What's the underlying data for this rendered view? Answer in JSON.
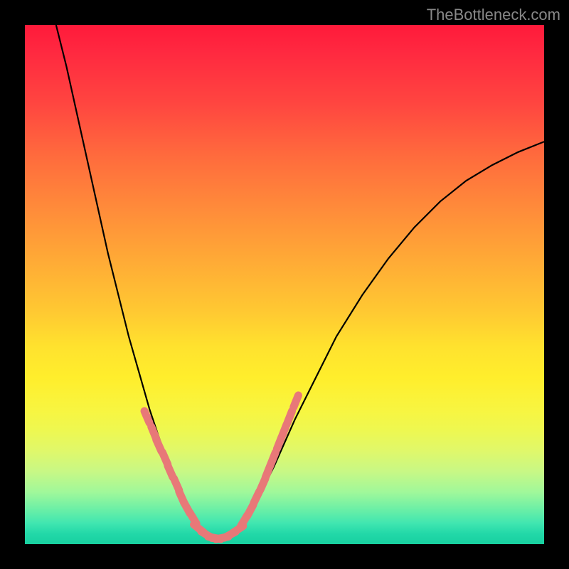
{
  "watermark": "TheBottleneck.com",
  "chart_data": {
    "type": "line",
    "title": "",
    "xlabel": "",
    "ylabel": "",
    "ylim": [
      0,
      1
    ],
    "xlim": [
      0,
      1
    ],
    "series": [
      {
        "name": "bottleneck-curve",
        "description": "V-shaped curve showing bottleneck percentage; minimum near x≈0.36",
        "curve_points": [
          {
            "x": 0.06,
            "y": 1.0
          },
          {
            "x": 0.08,
            "y": 0.92
          },
          {
            "x": 0.1,
            "y": 0.83
          },
          {
            "x": 0.12,
            "y": 0.74
          },
          {
            "x": 0.14,
            "y": 0.65
          },
          {
            "x": 0.16,
            "y": 0.56
          },
          {
            "x": 0.18,
            "y": 0.48
          },
          {
            "x": 0.2,
            "y": 0.4
          },
          {
            "x": 0.22,
            "y": 0.33
          },
          {
            "x": 0.24,
            "y": 0.26
          },
          {
            "x": 0.26,
            "y": 0.2
          },
          {
            "x": 0.28,
            "y": 0.15
          },
          {
            "x": 0.3,
            "y": 0.1
          },
          {
            "x": 0.32,
            "y": 0.06
          },
          {
            "x": 0.34,
            "y": 0.03
          },
          {
            "x": 0.36,
            "y": 0.01
          },
          {
            "x": 0.38,
            "y": 0.01
          },
          {
            "x": 0.4,
            "y": 0.02
          },
          {
            "x": 0.42,
            "y": 0.04
          },
          {
            "x": 0.44,
            "y": 0.07
          },
          {
            "x": 0.46,
            "y": 0.11
          },
          {
            "x": 0.48,
            "y": 0.15
          },
          {
            "x": 0.52,
            "y": 0.24
          },
          {
            "x": 0.56,
            "y": 0.32
          },
          {
            "x": 0.6,
            "y": 0.4
          },
          {
            "x": 0.65,
            "y": 0.48
          },
          {
            "x": 0.7,
            "y": 0.55
          },
          {
            "x": 0.75,
            "y": 0.61
          },
          {
            "x": 0.8,
            "y": 0.66
          },
          {
            "x": 0.85,
            "y": 0.7
          },
          {
            "x": 0.9,
            "y": 0.73
          },
          {
            "x": 0.95,
            "y": 0.755
          },
          {
            "x": 1.0,
            "y": 0.775
          }
        ]
      }
    ],
    "markers": {
      "description": "Short pink dash markers along lower portion of curve",
      "left_branch": [
        {
          "x": 0.235,
          "y": 0.245
        },
        {
          "x": 0.248,
          "y": 0.215
        },
        {
          "x": 0.258,
          "y": 0.19
        },
        {
          "x": 0.27,
          "y": 0.165
        },
        {
          "x": 0.28,
          "y": 0.14
        },
        {
          "x": 0.292,
          "y": 0.115
        },
        {
          "x": 0.302,
          "y": 0.09
        },
        {
          "x": 0.312,
          "y": 0.07
        },
        {
          "x": 0.324,
          "y": 0.05
        }
      ],
      "bottom": [
        {
          "x": 0.335,
          "y": 0.03
        },
        {
          "x": 0.35,
          "y": 0.018
        },
        {
          "x": 0.365,
          "y": 0.012
        },
        {
          "x": 0.38,
          "y": 0.012
        },
        {
          "x": 0.395,
          "y": 0.018
        },
        {
          "x": 0.41,
          "y": 0.028
        }
      ],
      "right_branch": [
        {
          "x": 0.422,
          "y": 0.045
        },
        {
          "x": 0.434,
          "y": 0.065
        },
        {
          "x": 0.446,
          "y": 0.09
        },
        {
          "x": 0.458,
          "y": 0.115
        },
        {
          "x": 0.468,
          "y": 0.14
        },
        {
          "x": 0.478,
          "y": 0.165
        },
        {
          "x": 0.49,
          "y": 0.195
        },
        {
          "x": 0.5,
          "y": 0.22
        },
        {
          "x": 0.51,
          "y": 0.245
        },
        {
          "x": 0.522,
          "y": 0.275
        }
      ]
    },
    "gradient_colors": {
      "top": "#ff1a3a",
      "mid_upper": "#ff8a3a",
      "mid": "#ffe22e",
      "mid_lower": "#c8f885",
      "bottom": "#18d0a0"
    }
  }
}
